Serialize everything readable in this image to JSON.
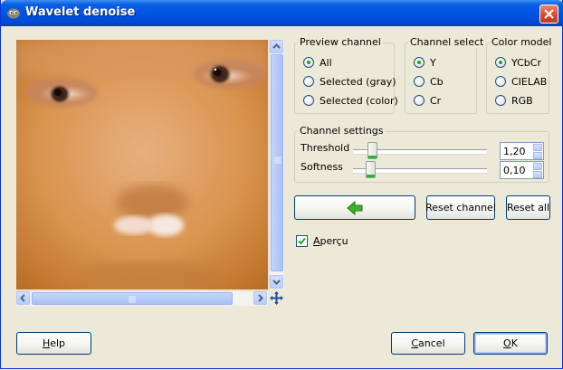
{
  "window": {
    "title": "Wavelet denoise"
  },
  "preview_channel": {
    "title": "Preview channel",
    "options": [
      {
        "label": "All",
        "selected": true
      },
      {
        "label": "Selected (gray)",
        "selected": false
      },
      {
        "label": "Selected (color)",
        "selected": false
      }
    ]
  },
  "channel_select": {
    "title": "Channel select",
    "options": [
      {
        "label": "Y",
        "selected": true
      },
      {
        "label": "Cb",
        "selected": false
      },
      {
        "label": "Cr",
        "selected": false
      }
    ]
  },
  "color_model": {
    "title": "Color model",
    "options": [
      {
        "label": "YCbCr",
        "selected": true
      },
      {
        "label": "CIELAB",
        "selected": false
      },
      {
        "label": "RGB",
        "selected": false
      }
    ]
  },
  "channel_settings": {
    "title": "Channel settings",
    "threshold": {
      "label": "Threshold",
      "value": "1,20",
      "fraction": 0.12
    },
    "softness": {
      "label": "Softness",
      "value": "0,10",
      "fraction": 0.1
    }
  },
  "actions": {
    "reset_channel": "Reset channel",
    "reset_all": "Reset all",
    "back_icon": "green-left-arrow"
  },
  "preview_toggle": {
    "label_first": "A",
    "label_rest": "perçu",
    "checked": true
  },
  "footer": {
    "help_first": "H",
    "help_rest": "elp",
    "cancel_first": "C",
    "cancel_rest": "ancel",
    "ok_first": "O",
    "ok_rest": "K"
  }
}
